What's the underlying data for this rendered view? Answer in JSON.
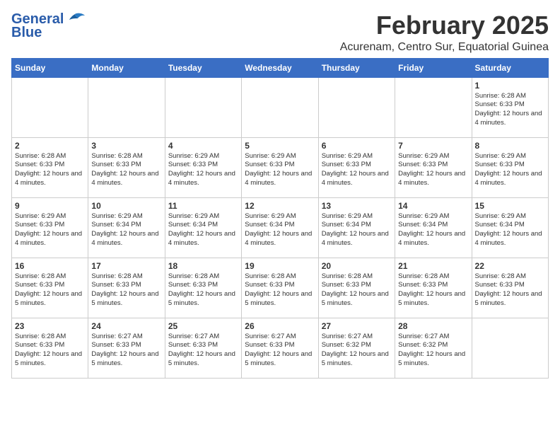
{
  "logo": {
    "general": "General",
    "blue": "Blue"
  },
  "title": {
    "month_year": "February 2025",
    "location": "Acurenam, Centro Sur, Equatorial Guinea"
  },
  "headers": [
    "Sunday",
    "Monday",
    "Tuesday",
    "Wednesday",
    "Thursday",
    "Friday",
    "Saturday"
  ],
  "weeks": [
    [
      {
        "day": "",
        "info": ""
      },
      {
        "day": "",
        "info": ""
      },
      {
        "day": "",
        "info": ""
      },
      {
        "day": "",
        "info": ""
      },
      {
        "day": "",
        "info": ""
      },
      {
        "day": "",
        "info": ""
      },
      {
        "day": "1",
        "info": "Sunrise: 6:28 AM\nSunset: 6:33 PM\nDaylight: 12 hours and 4 minutes."
      }
    ],
    [
      {
        "day": "2",
        "info": "Sunrise: 6:28 AM\nSunset: 6:33 PM\nDaylight: 12 hours and 4 minutes."
      },
      {
        "day": "3",
        "info": "Sunrise: 6:28 AM\nSunset: 6:33 PM\nDaylight: 12 hours and 4 minutes."
      },
      {
        "day": "4",
        "info": "Sunrise: 6:29 AM\nSunset: 6:33 PM\nDaylight: 12 hours and 4 minutes."
      },
      {
        "day": "5",
        "info": "Sunrise: 6:29 AM\nSunset: 6:33 PM\nDaylight: 12 hours and 4 minutes."
      },
      {
        "day": "6",
        "info": "Sunrise: 6:29 AM\nSunset: 6:33 PM\nDaylight: 12 hours and 4 minutes."
      },
      {
        "day": "7",
        "info": "Sunrise: 6:29 AM\nSunset: 6:33 PM\nDaylight: 12 hours and 4 minutes."
      },
      {
        "day": "8",
        "info": "Sunrise: 6:29 AM\nSunset: 6:33 PM\nDaylight: 12 hours and 4 minutes."
      }
    ],
    [
      {
        "day": "9",
        "info": "Sunrise: 6:29 AM\nSunset: 6:33 PM\nDaylight: 12 hours and 4 minutes."
      },
      {
        "day": "10",
        "info": "Sunrise: 6:29 AM\nSunset: 6:34 PM\nDaylight: 12 hours and 4 minutes."
      },
      {
        "day": "11",
        "info": "Sunrise: 6:29 AM\nSunset: 6:34 PM\nDaylight: 12 hours and 4 minutes."
      },
      {
        "day": "12",
        "info": "Sunrise: 6:29 AM\nSunset: 6:34 PM\nDaylight: 12 hours and 4 minutes."
      },
      {
        "day": "13",
        "info": "Sunrise: 6:29 AM\nSunset: 6:34 PM\nDaylight: 12 hours and 4 minutes."
      },
      {
        "day": "14",
        "info": "Sunrise: 6:29 AM\nSunset: 6:34 PM\nDaylight: 12 hours and 4 minutes."
      },
      {
        "day": "15",
        "info": "Sunrise: 6:29 AM\nSunset: 6:34 PM\nDaylight: 12 hours and 4 minutes."
      }
    ],
    [
      {
        "day": "16",
        "info": "Sunrise: 6:28 AM\nSunset: 6:33 PM\nDaylight: 12 hours and 5 minutes."
      },
      {
        "day": "17",
        "info": "Sunrise: 6:28 AM\nSunset: 6:33 PM\nDaylight: 12 hours and 5 minutes."
      },
      {
        "day": "18",
        "info": "Sunrise: 6:28 AM\nSunset: 6:33 PM\nDaylight: 12 hours and 5 minutes."
      },
      {
        "day": "19",
        "info": "Sunrise: 6:28 AM\nSunset: 6:33 PM\nDaylight: 12 hours and 5 minutes."
      },
      {
        "day": "20",
        "info": "Sunrise: 6:28 AM\nSunset: 6:33 PM\nDaylight: 12 hours and 5 minutes."
      },
      {
        "day": "21",
        "info": "Sunrise: 6:28 AM\nSunset: 6:33 PM\nDaylight: 12 hours and 5 minutes."
      },
      {
        "day": "22",
        "info": "Sunrise: 6:28 AM\nSunset: 6:33 PM\nDaylight: 12 hours and 5 minutes."
      }
    ],
    [
      {
        "day": "23",
        "info": "Sunrise: 6:28 AM\nSunset: 6:33 PM\nDaylight: 12 hours and 5 minutes."
      },
      {
        "day": "24",
        "info": "Sunrise: 6:27 AM\nSunset: 6:33 PM\nDaylight: 12 hours and 5 minutes."
      },
      {
        "day": "25",
        "info": "Sunrise: 6:27 AM\nSunset: 6:33 PM\nDaylight: 12 hours and 5 minutes."
      },
      {
        "day": "26",
        "info": "Sunrise: 6:27 AM\nSunset: 6:33 PM\nDaylight: 12 hours and 5 minutes."
      },
      {
        "day": "27",
        "info": "Sunrise: 6:27 AM\nSunset: 6:32 PM\nDaylight: 12 hours and 5 minutes."
      },
      {
        "day": "28",
        "info": "Sunrise: 6:27 AM\nSunset: 6:32 PM\nDaylight: 12 hours and 5 minutes."
      },
      {
        "day": "",
        "info": ""
      }
    ]
  ]
}
